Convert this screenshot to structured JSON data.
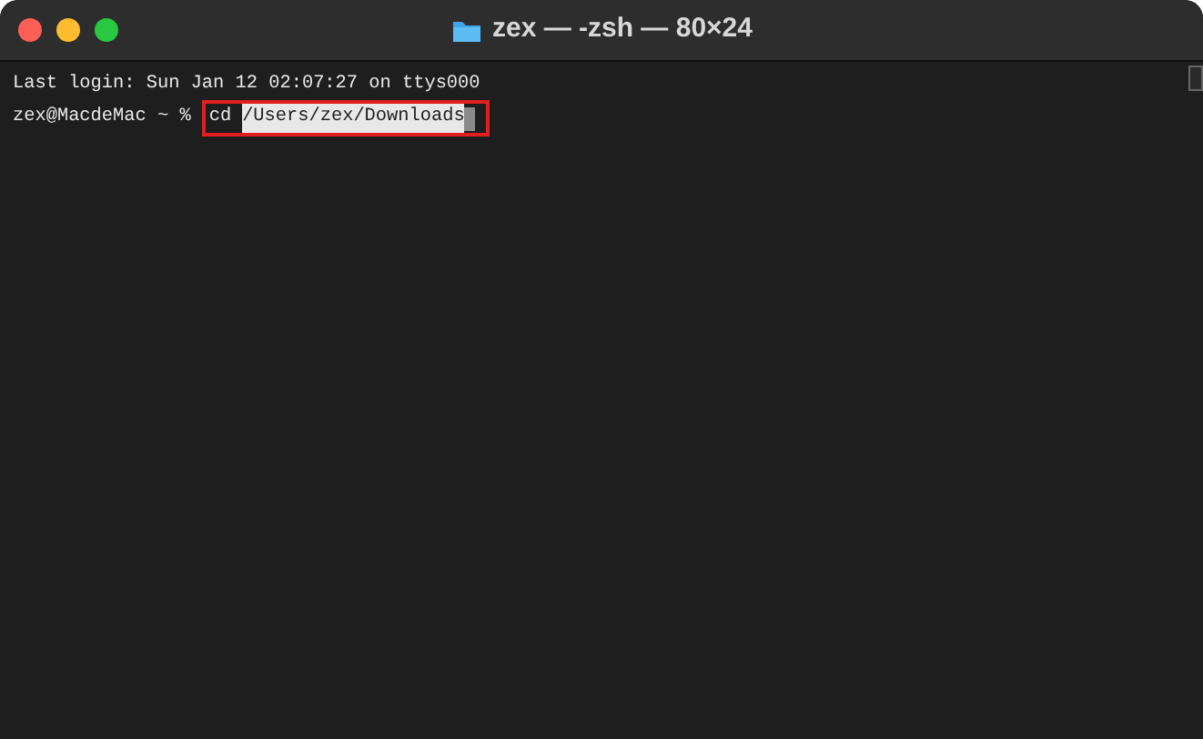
{
  "window": {
    "title": "zex — -zsh — 80×24"
  },
  "lines": [
    {
      "kind": "output",
      "text": "Last login: Sun Jan 12 02:07:27 on ttys000"
    },
    {
      "kind": "command",
      "prompt": "zex@MacdeMac ~ %",
      "command": "cd",
      "argument": "/Users/zex/Downloads",
      "argument_selected": true,
      "annotated": true
    }
  ]
}
